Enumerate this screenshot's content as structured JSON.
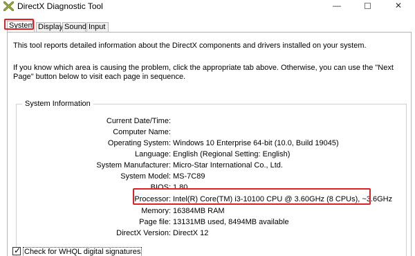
{
  "window": {
    "title": "DirectX Diagnostic Tool",
    "minimize_glyph": "—",
    "close_glyph": "✕",
    "icon": "directx-x-icon"
  },
  "tabs": [
    {
      "label": "System",
      "active": true
    },
    {
      "label": "Display",
      "active": false
    },
    {
      "label": "Sound",
      "active": false
    },
    {
      "label": "Input",
      "active": false
    }
  ],
  "intro": {
    "line1": "This tool reports detailed information about the DirectX components and drivers installed on your system.",
    "line2": "If you know which area is causing the problem, click the appropriate tab above.  Otherwise, you can use the \"Next Page\" button below to visit each page in sequence."
  },
  "system_info": {
    "title": "System Information",
    "rows": [
      {
        "label": "Current Date/Time:",
        "value": ""
      },
      {
        "label": "Computer Name:",
        "value": ""
      },
      {
        "label": "Operating System:",
        "value": "Windows 10 Enterprise 64-bit (10.0, Build 19045)"
      },
      {
        "label": "Language:",
        "value": "English (Regional Setting: English)"
      },
      {
        "label": "System Manufacturer:",
        "value": "Micro-Star International Co., Ltd."
      },
      {
        "label": "System Model:",
        "value": "MS-7C89"
      },
      {
        "label": "BIOS:",
        "value": "1.80"
      },
      {
        "label": "Processor:",
        "value": "Intel(R) Core(TM) i3-10100 CPU @ 3.60GHz (8 CPUs), ~3.6GHz"
      },
      {
        "label": "Memory:",
        "value": "16384MB RAM"
      },
      {
        "label": "Page file:",
        "value": "13131MB used, 8494MB available"
      },
      {
        "label": "DirectX Version:",
        "value": "DirectX 12"
      }
    ]
  },
  "whql": {
    "label": "Check for WHQL digital signatures",
    "checked": true
  },
  "colors": {
    "highlight": "#e02020",
    "border": "#b5b5b5"
  }
}
